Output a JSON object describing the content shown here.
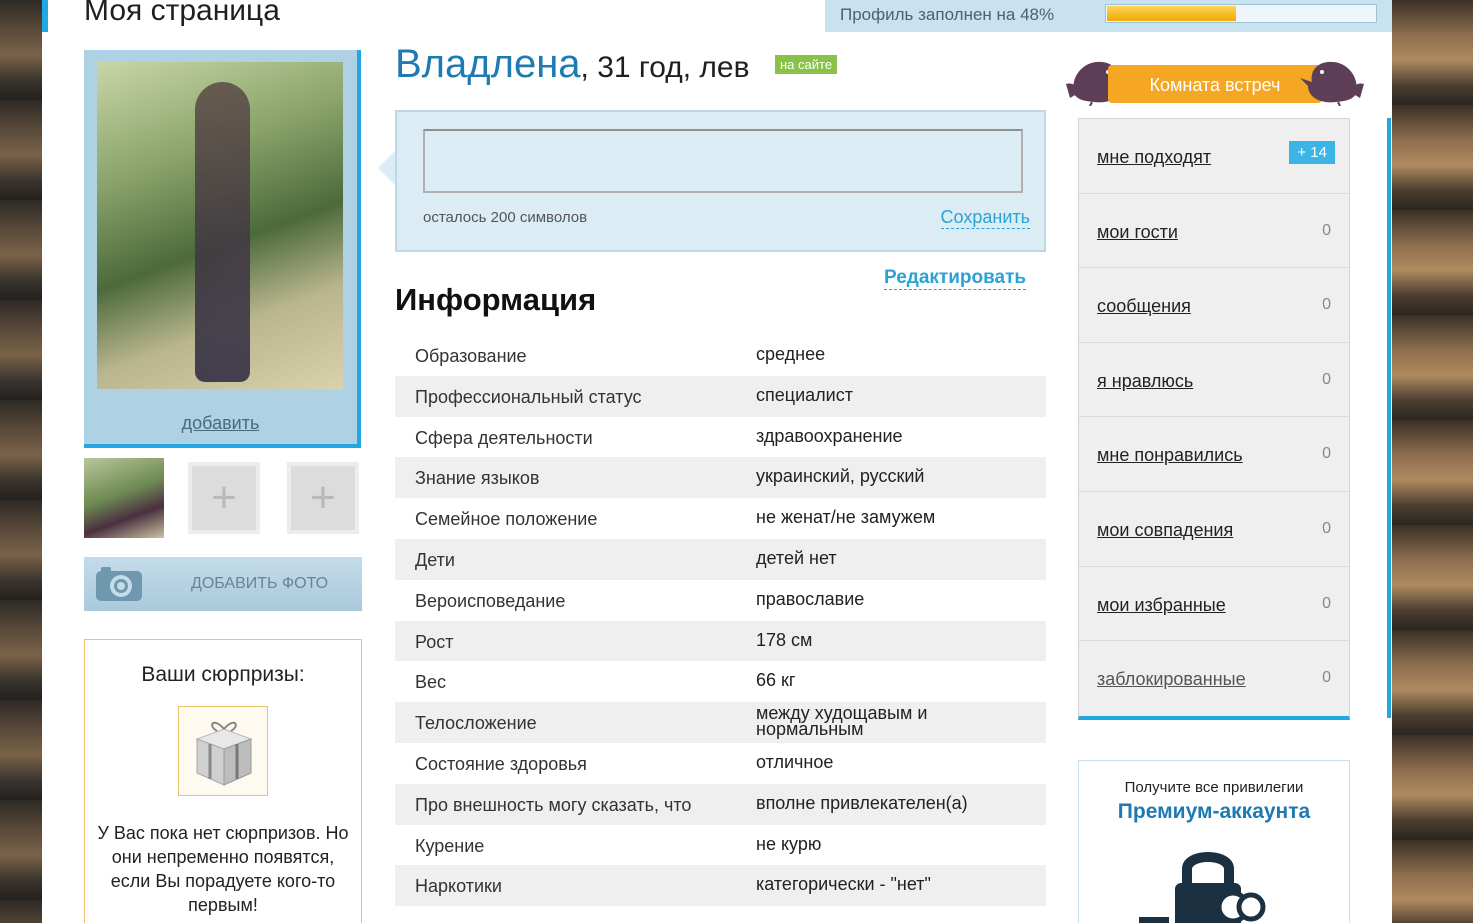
{
  "header": {
    "page_title": "Моя страница",
    "profile_progress_label": "Профиль заполнен на 48%",
    "profile_progress_value": 0.48
  },
  "photo": {
    "add_link": "добавить",
    "add_photo_button": "ДОБАВИТЬ ФОТО",
    "empty_slot_symbol": "+"
  },
  "surprises": {
    "title": "Ваши сюрпризы:",
    "message": "У Вас пока нет сюрпризов. Но они непременно появятся, если Вы порадуете кого-то первым!"
  },
  "profile": {
    "name": "Владлена",
    "details": ", 31 год, лев",
    "online_badge": "на сайте"
  },
  "status": {
    "value": "",
    "counter": "осталось 200 символов",
    "save_label": "Сохранить"
  },
  "info": {
    "edit_label": "Редактировать",
    "title": "Информация",
    "rows": [
      {
        "key": "Образование",
        "value": "среднее"
      },
      {
        "key": "Профессиональный статус",
        "value": "специалист"
      },
      {
        "key": "Сфера деятельности",
        "value": "здравоохранение"
      },
      {
        "key": "Знание языков",
        "value": "украинский, русский"
      },
      {
        "key": "Семейное положение",
        "value": "не женат/не замужем"
      },
      {
        "key": "Дети",
        "value": "детей нет"
      },
      {
        "key": "Вероисповедание",
        "value": "православие"
      },
      {
        "key": "Рост",
        "value": "178 см"
      },
      {
        "key": "Вес",
        "value": "66 кг"
      },
      {
        "key": "Телосложение",
        "value": "между худощавым и нормальным"
      },
      {
        "key": "Состояние здоровья",
        "value": "отличное"
      },
      {
        "key": "Про внешность могу сказать, что",
        "value": "вполне привлекателен(а)"
      },
      {
        "key": "Курение",
        "value": "не курю"
      },
      {
        "key": "Наркотики",
        "value": "категорически - \"нет\""
      }
    ]
  },
  "meeting_room": {
    "label": "Комната встреч"
  },
  "menu": {
    "items": [
      {
        "label": "мне подходят",
        "count": "+ 14",
        "badge": true
      },
      {
        "label": "мои гости",
        "count": "0"
      },
      {
        "label": "сообщения",
        "count": "0"
      },
      {
        "label": "я нравлюсь",
        "count": "0"
      },
      {
        "label": "мне понравились",
        "count": "0"
      },
      {
        "label": "мои совпадения",
        "count": "0"
      },
      {
        "label": "мои избранные",
        "count": "0"
      },
      {
        "label": "заблокированные",
        "count": "0"
      }
    ]
  },
  "premium": {
    "subtitle": "Получите все привилегии",
    "title": "Премиум-аккаунта"
  },
  "colors": {
    "accent": "#22a8e0",
    "link": "#2aa2d4",
    "name": "#1e7ab3",
    "online": "#8ac249",
    "meet_room": "#f5a623"
  },
  "icons": {
    "camera": "camera-icon",
    "gift": "gift-icon",
    "bird": "bird-icon",
    "lock": "lock-icon",
    "plus": "plus-icon"
  }
}
